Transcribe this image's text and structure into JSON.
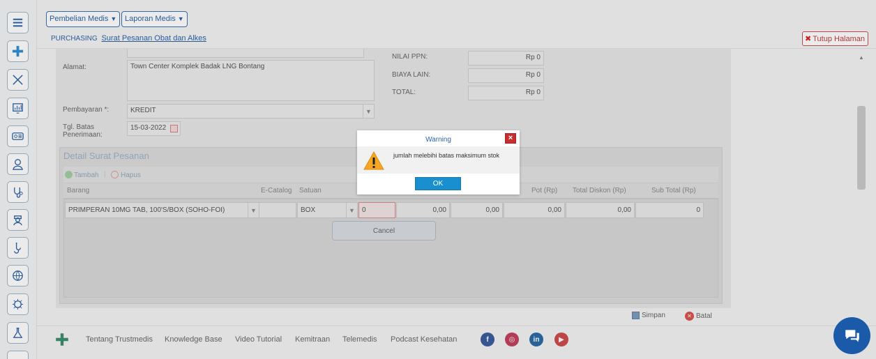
{
  "header": {
    "menu_pembelian": "Pembelian Medis",
    "menu_laporan": "Laporan Medis",
    "breadcrumb_root": "PURCHASING",
    "breadcrumb_page": "Surat Pesanan Obat dan Alkes",
    "close_page": "Tutup Halaman"
  },
  "form": {
    "alamat_label": "Alamat:",
    "alamat_value": "Town Center Komplek Badak LNG Bontang",
    "pembayaran_label": "Pembayaran *:",
    "pembayaran_value": "KREDIT",
    "tgl_label_1": "Tgl. Batas",
    "tgl_label_2": "Penerimaan:",
    "tgl_value": "15-03-2022",
    "ppn_label": "NILAI PPN:",
    "ppn_value": "Rp 0",
    "biaya_label": "BIAYA LAIN:",
    "biaya_value": "Rp 0",
    "total_label": "TOTAL:",
    "total_value": "Rp 0"
  },
  "detail": {
    "title": "Detail Surat Pesanan",
    "add": "Tambah",
    "delete": "Hapus",
    "columns": {
      "barang": "Barang",
      "ecatalog": "E-Catalog",
      "satuan": "Satuan",
      "pot": "Pot (Rp)",
      "total_diskon": "Total Diskon (Rp)",
      "sub_total": "Sub Total (Rp)"
    },
    "row": {
      "barang": "PRIMPERAN 10MG TAB, 100'S/BOX (SOHO-FOI)",
      "ecatalog": "",
      "satuan": "BOX",
      "qty": "0",
      "harga": "0,00",
      "diskon": "0,00",
      "pot": "0,00",
      "total_diskon": "0,00",
      "sub_total": "0"
    },
    "cancel": "Cancel"
  },
  "actions": {
    "save": "Simpan",
    "cancel": "Batal"
  },
  "footer": {
    "links": [
      "Tentang Trustmedis",
      "Knowledge Base",
      "Video Tutorial",
      "Kemitraan",
      "Telemedis",
      "Podcast Kesehatan"
    ]
  },
  "dialog": {
    "title": "Warning",
    "message": "jumlah melebihi batas maksimum stok",
    "ok": "OK"
  },
  "colors": {
    "accent": "#2f64a8",
    "ok_button": "#1a8fcf",
    "close_button": "#c62f2f",
    "chat_button": "#1a5aa8"
  },
  "icons": [
    "menu-icon",
    "trustmedis-logo-icon",
    "tools-icon",
    "chart-board-icon",
    "id-card-icon",
    "doctor-icon",
    "stethoscope-icon",
    "nurse-icon",
    "medical-icon",
    "globe-icon",
    "virus-icon",
    "lab-flask-icon",
    "warning-icon",
    "chat-icon"
  ]
}
